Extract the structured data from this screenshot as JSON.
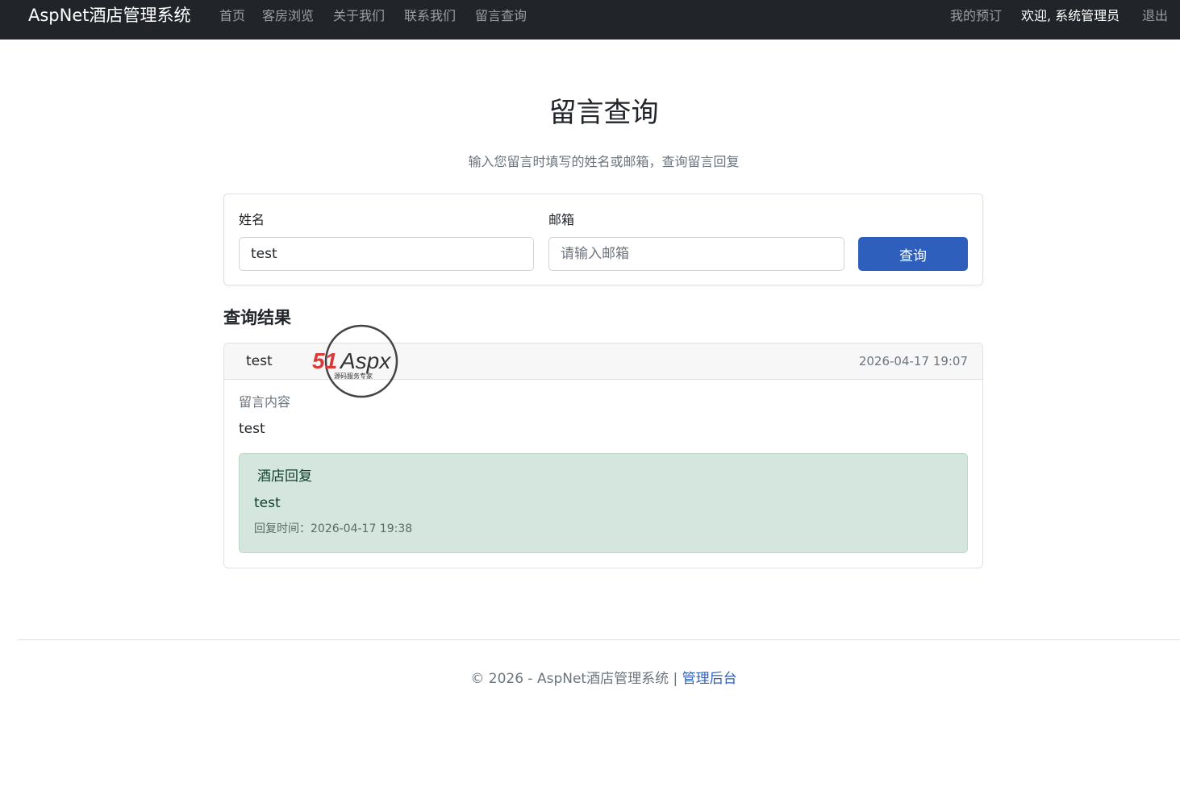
{
  "navbar": {
    "brand": "AspNet酒店管理系统",
    "links": [
      "首页",
      "客房浏览",
      "关于我们",
      "联系我们",
      "留言查询"
    ],
    "my_booking": "我的预订",
    "welcome": "欢迎, 系统管理员",
    "logout": "退出"
  },
  "header": {
    "title": "留言查询",
    "subtitle": "输入您留言时填写的姓名或邮箱，查询留言回复"
  },
  "search": {
    "name_label": "姓名",
    "name_value": "test",
    "email_label": "邮箱",
    "email_placeholder": "请输入邮箱",
    "email_value": "",
    "submit_label": "查询"
  },
  "results": {
    "title": "查询结果",
    "items": [
      {
        "name": "test",
        "date": "2026-04-17 19:07",
        "content_label": "留言内容",
        "content": "test",
        "reply": {
          "title": "酒店回复",
          "text": "test",
          "time": "回复时间：2026-04-17 19:38"
        }
      }
    ]
  },
  "watermark": {
    "brand_red": "51",
    "brand_dark": "Aspx",
    "tagline": "源码服务专家"
  },
  "footer": {
    "text": "© 2026 - AspNet酒店管理系统 | ",
    "admin_link": "管理后台"
  },
  "colors": {
    "navbar_bg": "#212529",
    "primary": "#2f5fbd",
    "reply_bg": "#d4e6de"
  }
}
